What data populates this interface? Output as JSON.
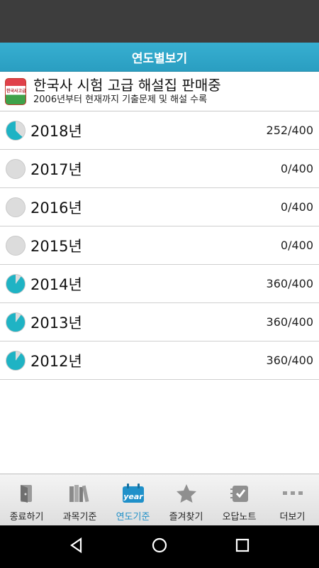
{
  "header": {
    "title": "연도별보기"
  },
  "promo": {
    "icon_text": "한국사고급",
    "title": "한국사 시험 고급 해설집 판매중",
    "subtitle": "2006년부터 현재까지 기출문제 및 해설 수록"
  },
  "years": [
    {
      "label": "2018년",
      "score": "252/400",
      "progress": 0.63
    },
    {
      "label": "2017년",
      "score": "0/400",
      "progress": 0
    },
    {
      "label": "2016년",
      "score": "0/400",
      "progress": 0
    },
    {
      "label": "2015년",
      "score": "0/400",
      "progress": 0
    },
    {
      "label": "2014년",
      "score": "360/400",
      "progress": 0.9
    },
    {
      "label": "2013년",
      "score": "360/400",
      "progress": 0.9
    },
    {
      "label": "2012년",
      "score": "360/400",
      "progress": 0.9
    }
  ],
  "bottom_nav": [
    {
      "label": "종료하기",
      "icon": "exit-door-icon"
    },
    {
      "label": "과목기준",
      "icon": "books-icon"
    },
    {
      "label": "연도기준",
      "icon": "calendar-year-icon",
      "active": true,
      "icon_text": "year"
    },
    {
      "label": "즐겨찾기",
      "icon": "star-icon"
    },
    {
      "label": "오답노트",
      "icon": "notebook-check-icon"
    },
    {
      "label": "더보기",
      "icon": "more-dots-icon"
    }
  ],
  "colors": {
    "accent": "#29a9d0",
    "pie_fill": "#1fb3c4",
    "pie_empty": "#dcdcdc",
    "active_nav": "#1e8fc7"
  }
}
